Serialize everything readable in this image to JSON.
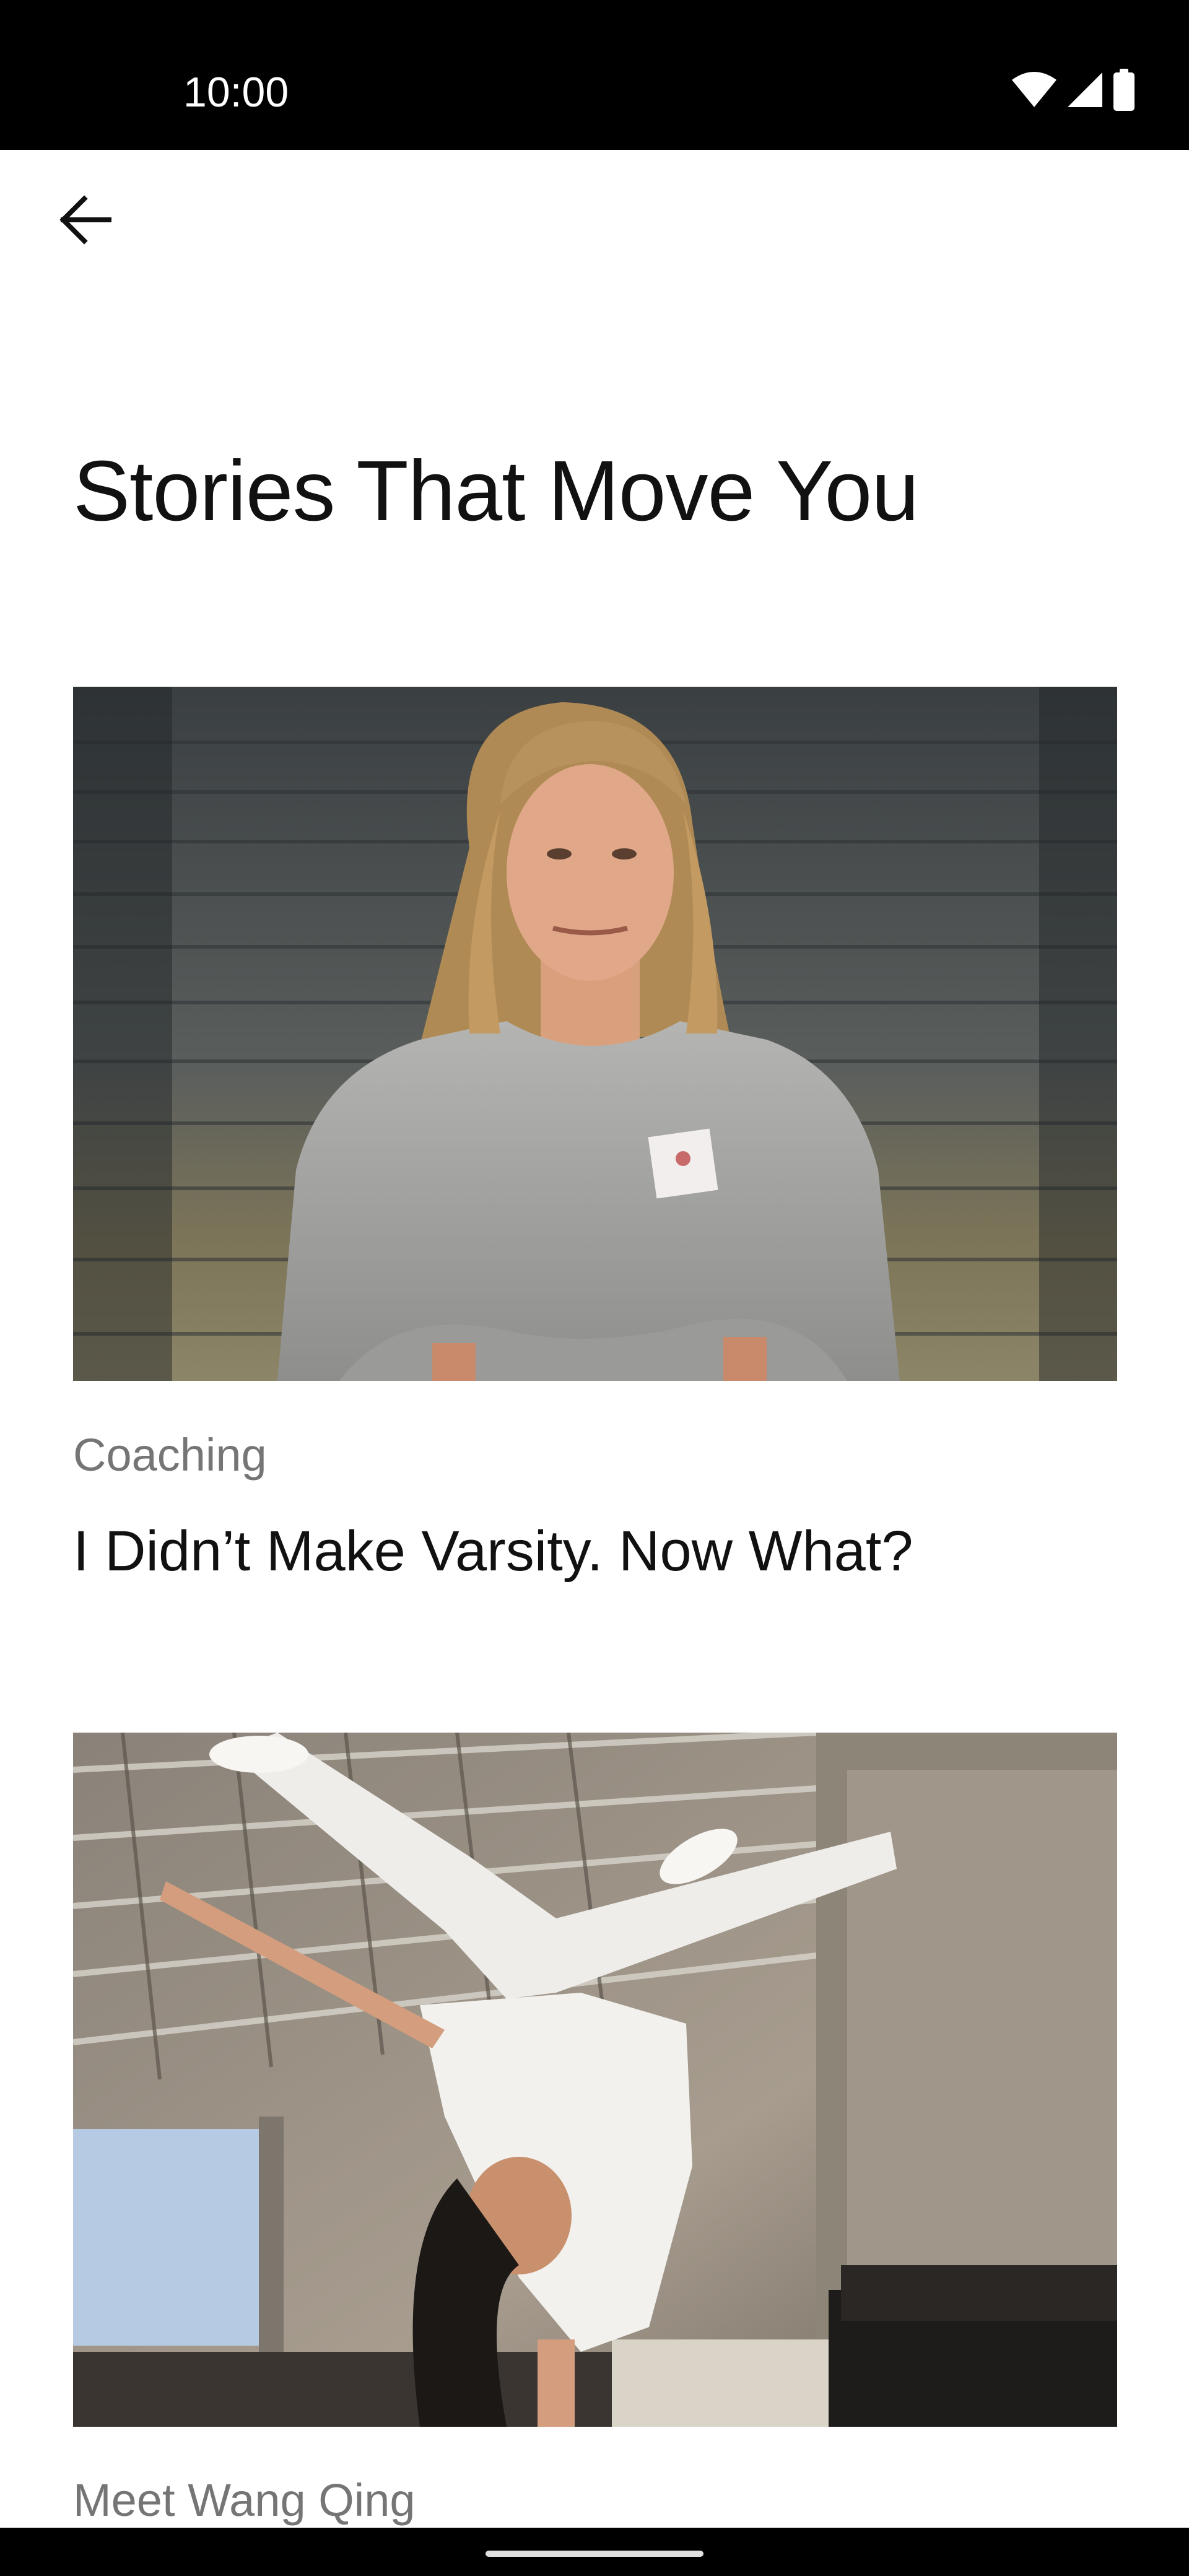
{
  "status_bar": {
    "time": "10:00",
    "icons": [
      "wifi-icon",
      "signal-icon",
      "battery-icon"
    ]
  },
  "app_bar": {
    "back_icon": "arrow-left-icon"
  },
  "page": {
    "title": "Stories That Move You"
  },
  "stories": [
    {
      "image": "photo of a coach in a grey sweatshirt with arms crossed on bleachers",
      "category": "Coaching",
      "headline": "I Didn’t Make Varsity. Now What?"
    },
    {
      "image": "photo of a breakdancer in white doing a one-hand freeze in a studio",
      "category": "Meet Wang Qing",
      "headline": ""
    }
  ],
  "colors": {
    "status_bar_bg": "#000000",
    "background": "#ffffff",
    "title_text": "#111111",
    "category_text": "#757575"
  }
}
